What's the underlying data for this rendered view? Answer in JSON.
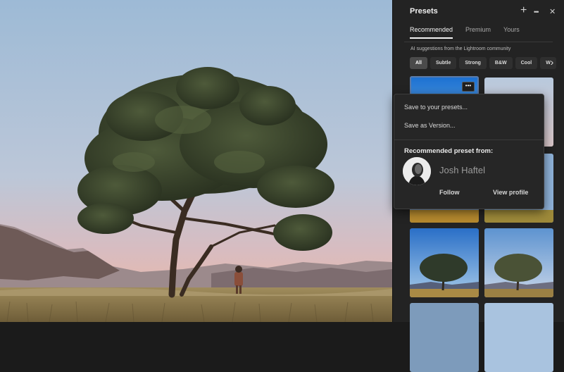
{
  "panel": {
    "title": "Presets",
    "header_icons": [
      "plus-icon",
      "more-icon",
      "close-icon"
    ],
    "header_glyphs": {
      "add": "+",
      "more": "•••",
      "close": "✕"
    },
    "tabs": [
      {
        "label": "Recommended",
        "active": true
      },
      {
        "label": "Premium",
        "active": false
      },
      {
        "label": "Yours",
        "active": false
      }
    ],
    "suggestion_text": "AI suggestions from the Lightroom community",
    "filters": [
      {
        "label": "All",
        "active": true
      },
      {
        "label": "Subtle",
        "active": false
      },
      {
        "label": "Strong",
        "active": false
      },
      {
        "label": "B&W",
        "active": false
      },
      {
        "label": "Cool",
        "active": false
      },
      {
        "label": "W",
        "active": false
      }
    ],
    "filter_next_glyph": "›",
    "thumb_menu_glyph": "•••"
  },
  "popup": {
    "menu_items": [
      "Save to your presets...",
      "Save as Version..."
    ],
    "recommended_label": "Recommended preset from:",
    "author_name": "Josh Haftel",
    "follow_label": "Follow",
    "view_profile_label": "View profile"
  },
  "colors": {
    "panel_bg": "#232323",
    "popup_bg": "#262626",
    "sky_top": "#9fbbd8",
    "sky_bottom": "#e8b8ae",
    "grass": "#8a7a52"
  }
}
